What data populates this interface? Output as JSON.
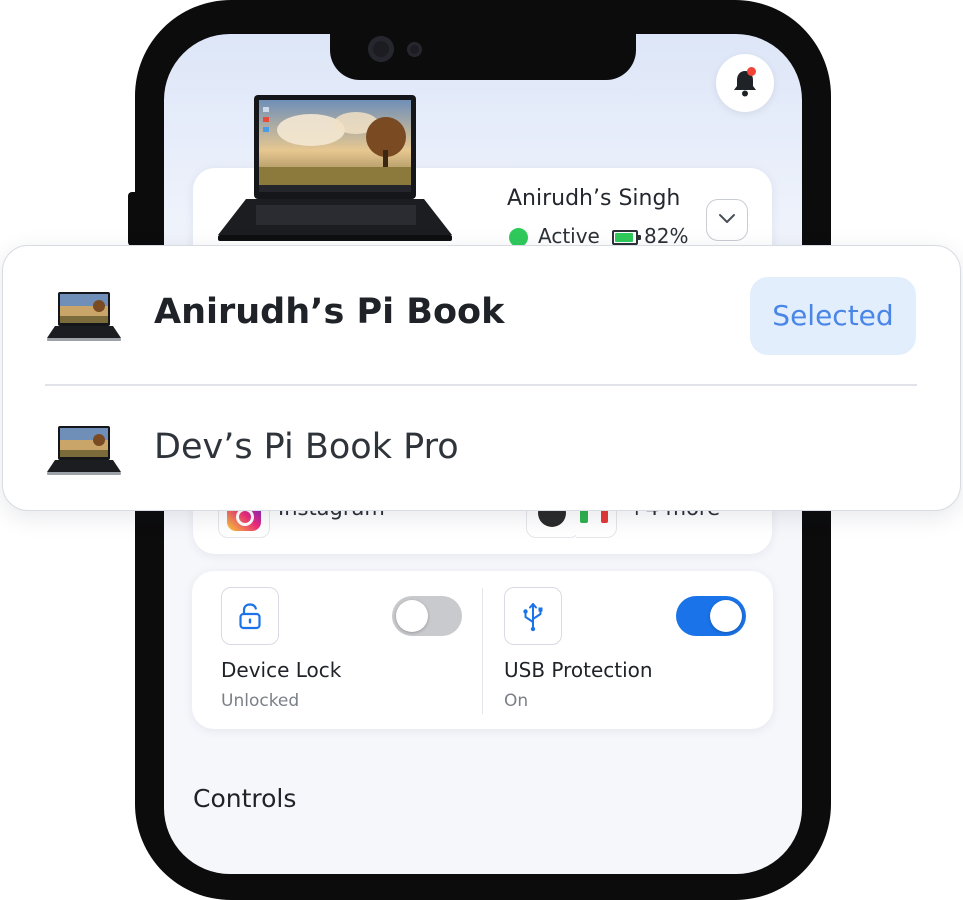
{
  "device_card": {
    "owner_name": "Anirudh’s Singh",
    "status": "Active",
    "status_color": "#2fca5b",
    "battery_percent": "82%",
    "battery_level": 0.82,
    "expand_icon": "chevron-down-icon"
  },
  "header": {
    "notification_icon": "bell-icon",
    "notification_badge_color": "#f04438"
  },
  "device_switcher": {
    "devices": [
      {
        "name": "Anirudh’s Pi Book",
        "selected": true,
        "selected_label": "Selected"
      },
      {
        "name": "Dev’s Pi Book Pro",
        "selected": false
      }
    ]
  },
  "apps_card": {
    "first_app": "Instagram",
    "more_label": "+4 more"
  },
  "toggles": {
    "device_lock": {
      "title": "Device Lock",
      "status": "Unlocked",
      "enabled": false,
      "icon": "unlock-icon"
    },
    "usb_protection": {
      "title": "USB Protection",
      "status": "On",
      "enabled": true,
      "icon": "usb-icon"
    }
  },
  "sections": {
    "controls_heading": "Controls"
  },
  "colors": {
    "accent": "#1a73e8",
    "selected_pill_bg": "#e3eefc",
    "selected_pill_text": "#4a86e8",
    "toggle_off": "#c9cacd"
  }
}
